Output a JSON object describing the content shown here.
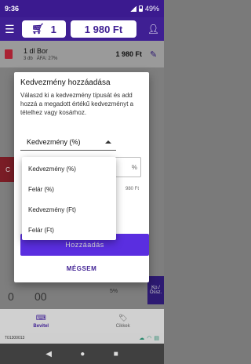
{
  "status": {
    "time": "9:36",
    "battery": "49%"
  },
  "appbar": {
    "cart_count": "1",
    "total": "1 980 Ft"
  },
  "item": {
    "name": "1 dl Bor",
    "qty": "3 db",
    "vat": "ÁFA: 27%",
    "price": "1 980 Ft"
  },
  "dialog": {
    "title": "Kedvezmény hozzáadása",
    "description": "Válaszd ki a kedvezmény típusát és add hozzá a megadott értékű kedvezményt a tételhez vagy kosárhoz.",
    "selected_type": "Kedvezmény (%)",
    "field_suffix": "%",
    "helper_text": "980 Ft",
    "add_label": "Hozzáadás",
    "cancel_label": "MÉGSEM"
  },
  "dropdown": {
    "options": [
      "Kedvezmény (%)",
      "Felár (%)",
      "Kedvezmény (Ft)",
      "Felár (Ft)"
    ]
  },
  "background": {
    "cell1": "0",
    "cell2": "00",
    "purple_label": "Kp./ Össz.",
    "pct": "5%"
  },
  "tabs": [
    {
      "label": "Bevitel",
      "icon": "keyboard-icon"
    },
    {
      "label": "Cikkek",
      "icon": "tag-icon"
    }
  ],
  "footer": {
    "device_id": "T01300013"
  },
  "colors": {
    "primary": "#3f1f93",
    "accent": "#5a2ee0",
    "danger": "#a23"
  }
}
